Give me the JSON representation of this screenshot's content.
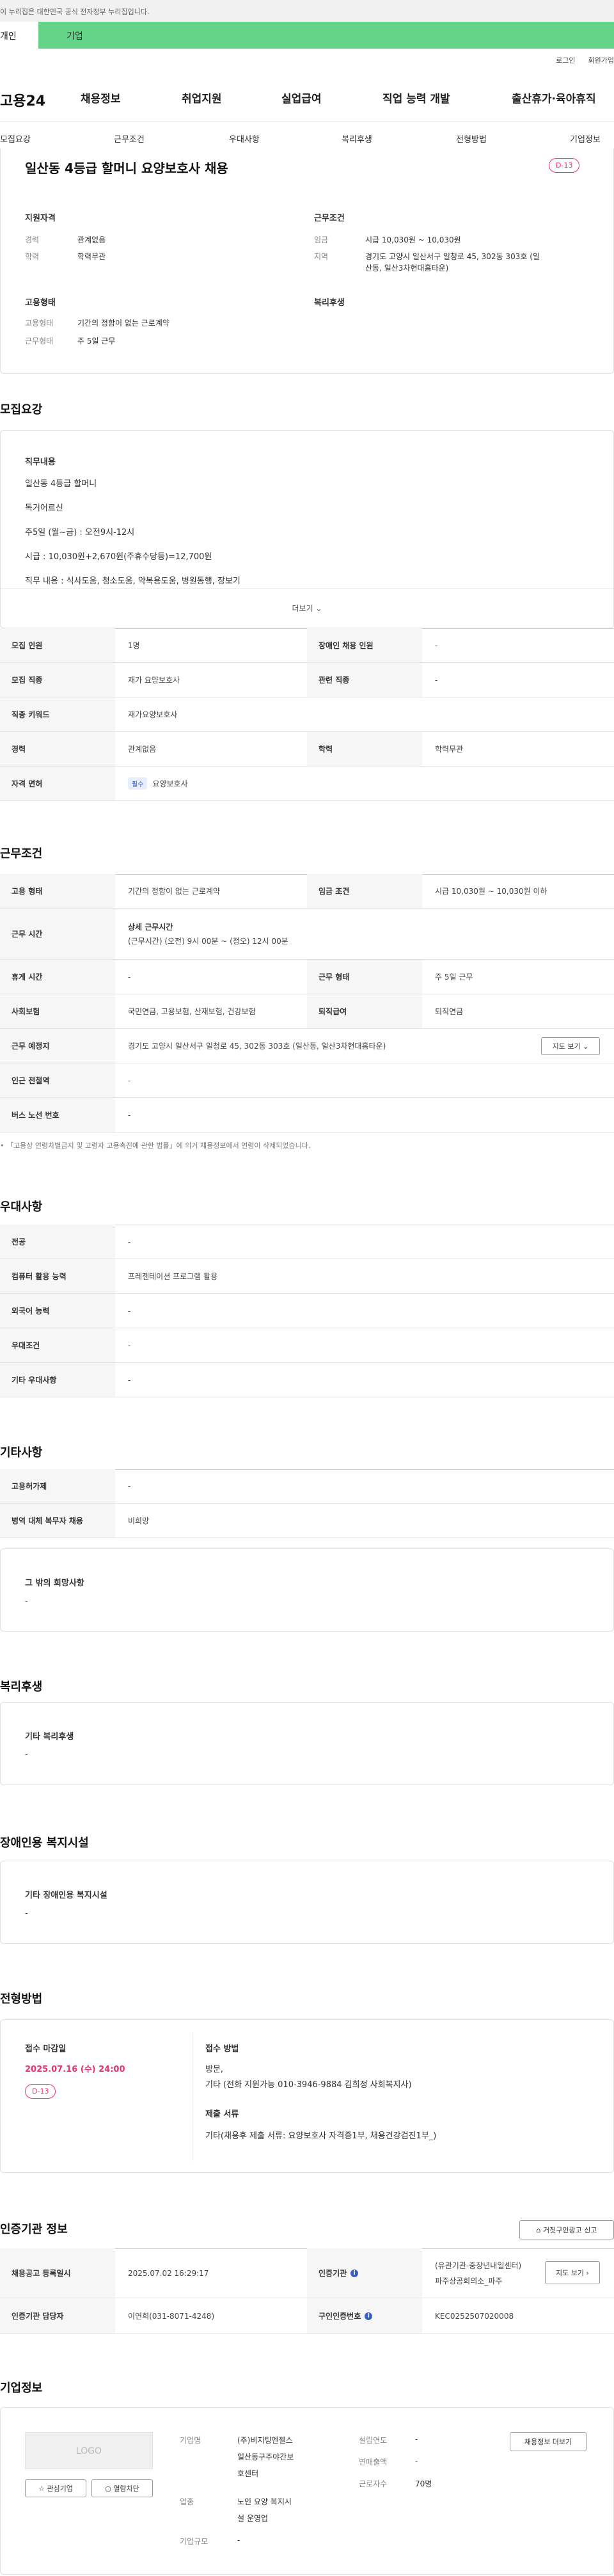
{
  "gov_banner": "이 누리집은 대한민국 공식 전자정부 누리집입니다.",
  "top_tabs": [
    "개인",
    "기업"
  ],
  "util": [
    "로그인",
    "회원가입"
  ],
  "logo": "고용24",
  "gnb": [
    "채용정보",
    "취업지원",
    "실업급여",
    "직업 능력 개발",
    "출산휴가·육아휴직"
  ],
  "snb": [
    "모집요강",
    "근무조건",
    "우대사항",
    "복리후생",
    "전형방법",
    "기업정보"
  ],
  "job": {
    "title": "일산동 4등급 할머니 요양보호사 채용",
    "dday": "D-13",
    "qual_label": "지원자격",
    "career_k": "경력",
    "career_v": "관계없음",
    "edu_k": "학력",
    "edu_v": "학력무관",
    "cond_label": "근무조건",
    "wage_k": "임금",
    "wage_v": "시급 10,030원 ~ 10,030원",
    "area_k": "지역",
    "area_v1": "경기도 고양시 일산서구 일청로 45, 302동 303호 (일",
    "area_v2": "산동, 일산3차현대홈타운)",
    "emp_label": "고용형태",
    "emptype_k": "고용형태",
    "emptype_v": "기간의 정함이 없는 근로계약",
    "worktype_k": "근무형태",
    "worktype_v": "주 5일 근무",
    "welfare_label": "복리후생"
  },
  "recruit": {
    "title": "모집요강",
    "duty_label": "직무내용",
    "lines": [
      "일산동 4등급 할머니",
      "독거어르신",
      "주5일 (월~금) : 오전9시-12시",
      "시급 : 10,030원+2,670원(주휴수당등)=12,700원",
      "직무 내용 : 식사도움, 청소도움, 약복용도움, 병원동행, 장보기"
    ],
    "more": "더보기",
    "rows": [
      [
        "모집 인원",
        "1명",
        "장애인 채용 인원",
        "-"
      ],
      [
        "모집 직종",
        "재가 요양보호사",
        "관련 직종",
        "-"
      ],
      [
        "직종 키워드",
        "재가요양보호사"
      ],
      [
        "경력",
        "관계없음",
        "학력",
        "학력무관"
      ],
      [
        "자격 면허",
        "필수",
        "요양보호사"
      ]
    ]
  },
  "cond": {
    "title": "근무조건",
    "r1": [
      "고용 형태",
      "기간의 정함이 없는 근로계약",
      "임금 조건",
      "시급 10,030원 ~ 10,030원 이하"
    ],
    "r2": [
      "근무 시간",
      "상세 근무시간",
      "(근무시간) (오전) 9시 00분 ~ (정오) 12시 00분"
    ],
    "r3": [
      "휴게 시간",
      "-",
      "근무 형태",
      "주 5일 근무"
    ],
    "r4": [
      "사회보험",
      "국민연금, 고용보험, 산재보험, 건강보험",
      "퇴직급여",
      "퇴직연금"
    ],
    "r5": [
      "근무 예정지",
      "경기도 고양시 일산서구 일청로 45, 302동 303호 (일산동, 일산3차현대홈타운)",
      "지도 보기"
    ],
    "r6": [
      "인근 전철역",
      "-"
    ],
    "r7": [
      "버스 노선 번호",
      "-"
    ],
    "note": "「고용상 연령차별금지 및 고령자 고용촉진에 관한 법률」에 의거 채용정보에서 연령이 삭제되었습니다."
  },
  "pref": {
    "title": "우대사항",
    "rows": [
      [
        "전공",
        "-"
      ],
      [
        "컴퓨터 활용 능력",
        "프레젠테이션 프로그램 활용"
      ],
      [
        "외국어 능력",
        "-"
      ],
      [
        "우대조건",
        "-"
      ],
      [
        "기타 우대사항",
        "-"
      ]
    ]
  },
  "etc": {
    "title": "기타사항",
    "rows": [
      [
        "고용허가제",
        "-"
      ],
      [
        "병역 대체 복무자 채용",
        "비희망"
      ]
    ],
    "other_label": "그 밖의 희망사항",
    "other_v": "-"
  },
  "welfare": {
    "title": "복리후생",
    "label": "기타 복리후생",
    "v": "-"
  },
  "disab": {
    "title": "장애인용 복지시설",
    "label": "기타 장애인용 복지시설",
    "v": "-"
  },
  "sel": {
    "title": "전형방법",
    "deadline_label": "접수 마감일",
    "deadline": "2025.07.16 (수) 24:00",
    "dday": "D-13",
    "method_label": "접수 방법",
    "method1": "방문,",
    "method2": "기타 (전화 지원가능 010-3946-9884 김희정 사회복지사)",
    "docs_label": "제출 서류",
    "docs": "기타(채용후 제출 서류: 요양보호사 자격증1부, 채용건강검진1부_)"
  },
  "cert": {
    "title": "인증기관 정보",
    "report": "거짓구인광고 신고",
    "r1": [
      "채용공고 등록일시",
      "2025.07.02 16:29:17",
      "인증기관",
      "(유관기관-중장년내일센터)",
      "파주상공회의소_파주",
      "지도 보기"
    ],
    "r2": [
      "인증기관 담당자",
      "이연희(031-8071-4248)",
      "구인인증번호",
      "KEC0252507020008"
    ]
  },
  "company": {
    "title": "기업정보",
    "logo": "LOGO",
    "fav": "관심기업",
    "block": "열람차단",
    "name_k": "기업명",
    "name_v": [
      "(주)비지팅엔젤스",
      "일산동구주야간보",
      "호센터"
    ],
    "ind_k": "업종",
    "ind_v": [
      "노인 요양 복지시",
      "설 운영업"
    ],
    "size_k": "기업규모",
    "size_v": "-",
    "year_k": "설립연도",
    "year_v": "-",
    "sales_k": "연매출액",
    "sales_v": "-",
    "emp_k": "근로자수",
    "emp_v": "70명",
    "more": "채용정보 더보기"
  }
}
